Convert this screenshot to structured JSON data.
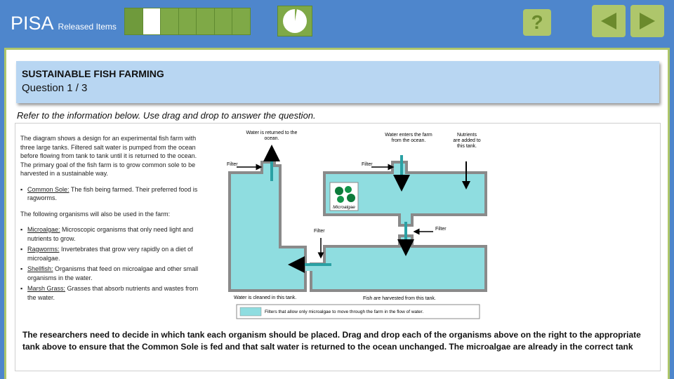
{
  "header": {
    "brand": "PISA",
    "subtitle": "Released Items",
    "progress_segments": 7,
    "progress_current": 2,
    "help_label": "?"
  },
  "question": {
    "title": "SUSTAINABLE FISH FARMING",
    "number": "Question 1 / 3",
    "instruction": "Refer to the information below. Use drag and drop to answer the question."
  },
  "stimulus": {
    "intro": "The diagram shows a design for an experimental fish farm with three large tanks. Filtered salt water is pumped from the ocean before flowing from tank to tank until it is returned to the ocean. The primary goal of the fish farm is to grow common sole to be harvested in a sustainable way.",
    "sole": {
      "term": "Common Sole:",
      "desc": " The fish being farmed. Their preferred food is ragworms."
    },
    "others_intro": "The following organisms will also be used in the farm:",
    "organisms": [
      {
        "term": "Microalgae:",
        "desc": " Microscopic organisms that only need light and nutrients to grow."
      },
      {
        "term": "Ragworms:",
        "desc": " Invertebrates that grow very rapidly on a diet of microalgae."
      },
      {
        "term": "Shellfish:",
        "desc": " Organisms that feed on microalgae and other small organisms in the water."
      },
      {
        "term": "Marsh Grass:",
        "desc": " Grasses that absorb nutrients and wastes from the water."
      }
    ]
  },
  "diagram": {
    "label_returned": [
      "Water is returned to the",
      "ocean."
    ],
    "label_enters": [
      "Water enters the farm",
      "from the ocean."
    ],
    "label_nutrients": [
      "Nutrients",
      "are added to",
      "this tank."
    ],
    "filter": "Filter",
    "microalgae": "Microalgae",
    "label_cleaned": "Water is cleaned in this tank.",
    "label_harvested": "Fish are harvested from this tank.",
    "legend": "Filters that allow only microalgae to move through the farm in the flow of water."
  },
  "task": "The researchers need to decide in which tank each organism should be placed. Drag and drop each of the organisms above on the right to the appropriate tank above to ensure that the Common Sole is fed and that salt water is  returned to the ocean unchanged. The microalgae are already in the correct tank",
  "colors": {
    "frame_blue": "#4e86cc",
    "nav_green": "#aec66b",
    "header_blue": "#b8d6f2",
    "water": "#8fdde0",
    "arrow_teal": "#2aa1a4"
  }
}
